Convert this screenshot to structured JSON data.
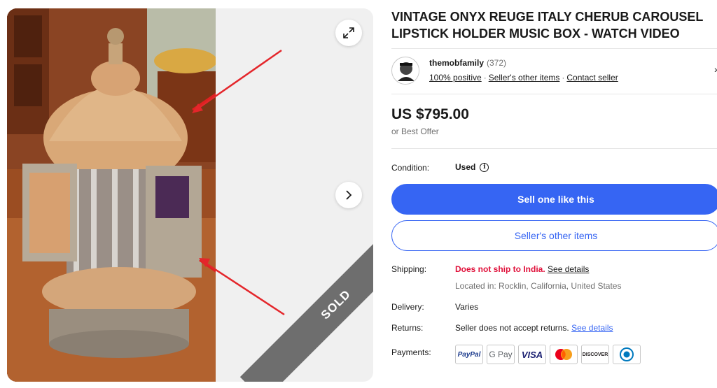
{
  "listing": {
    "title": "VINTAGE ONYX REUGE ITALY CHERUB CAROUSEL LIPSTICK HOLDER MUSIC BOX - WATCH VIDEO",
    "sold_label": "SOLD"
  },
  "seller": {
    "name": "themobfamily",
    "feedback_count": "(372)",
    "positive": "100% positive",
    "other_items": "Seller's other items",
    "contact": "Contact seller",
    "separator": "·",
    "chevron": "›"
  },
  "price": {
    "amount": "US $795.00",
    "offer": "or Best Offer"
  },
  "condition": {
    "label": "Condition:",
    "value": "Used",
    "info": "i"
  },
  "buttons": {
    "primary": "Sell one like this",
    "secondary": "Seller's other items"
  },
  "shipping": {
    "label": "Shipping:",
    "warning": "Does not ship to India.",
    "details_link": "See details",
    "location": "Located in: Rocklin, California, United States"
  },
  "delivery": {
    "label": "Delivery:",
    "value": "Varies"
  },
  "returns": {
    "label": "Returns:",
    "value": "Seller does not accept returns.",
    "details_link": "See details"
  },
  "payments": {
    "label": "Payments:",
    "methods": [
      {
        "name": "paypal-icon",
        "text": "PayPal"
      },
      {
        "name": "gpay-icon",
        "text": "G Pay"
      },
      {
        "name": "visa-icon",
        "text": "VISA"
      },
      {
        "name": "mastercard-icon",
        "text": ""
      },
      {
        "name": "discover-icon",
        "text": "DISCOVER"
      },
      {
        "name": "diners-icon",
        "text": ""
      }
    ]
  },
  "colors": {
    "accent": "#3665f3",
    "warning": "#e0103a",
    "text": "#191919",
    "muted": "#707070",
    "sold_band": "#6e6e6e"
  }
}
